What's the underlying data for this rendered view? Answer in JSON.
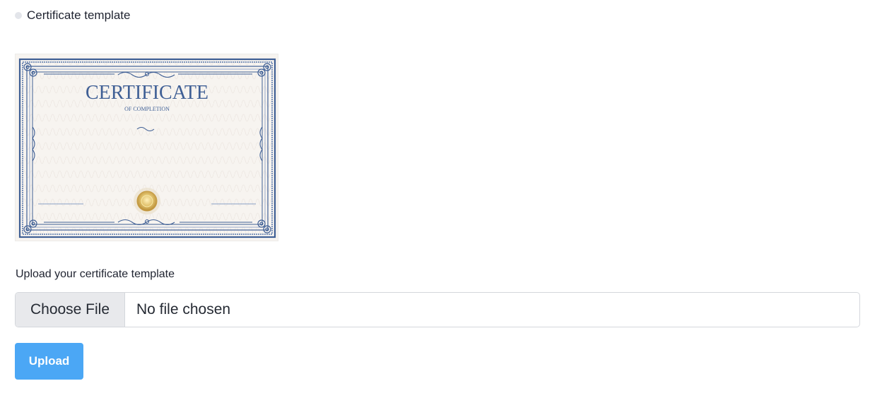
{
  "section": {
    "title": "Certificate template"
  },
  "certificate_preview": {
    "heading": "CERTIFICATE",
    "subheading": "OF COMPLETION",
    "border_color": "#3f5f95",
    "paper_color": "#f7f4f0",
    "seal_color": "#d8b75b"
  },
  "upload": {
    "label": "Upload your certificate template",
    "choose_file_label": "Choose File",
    "file_status": "No file chosen",
    "button_label": "Upload",
    "button_color": "#4ba7f5"
  }
}
